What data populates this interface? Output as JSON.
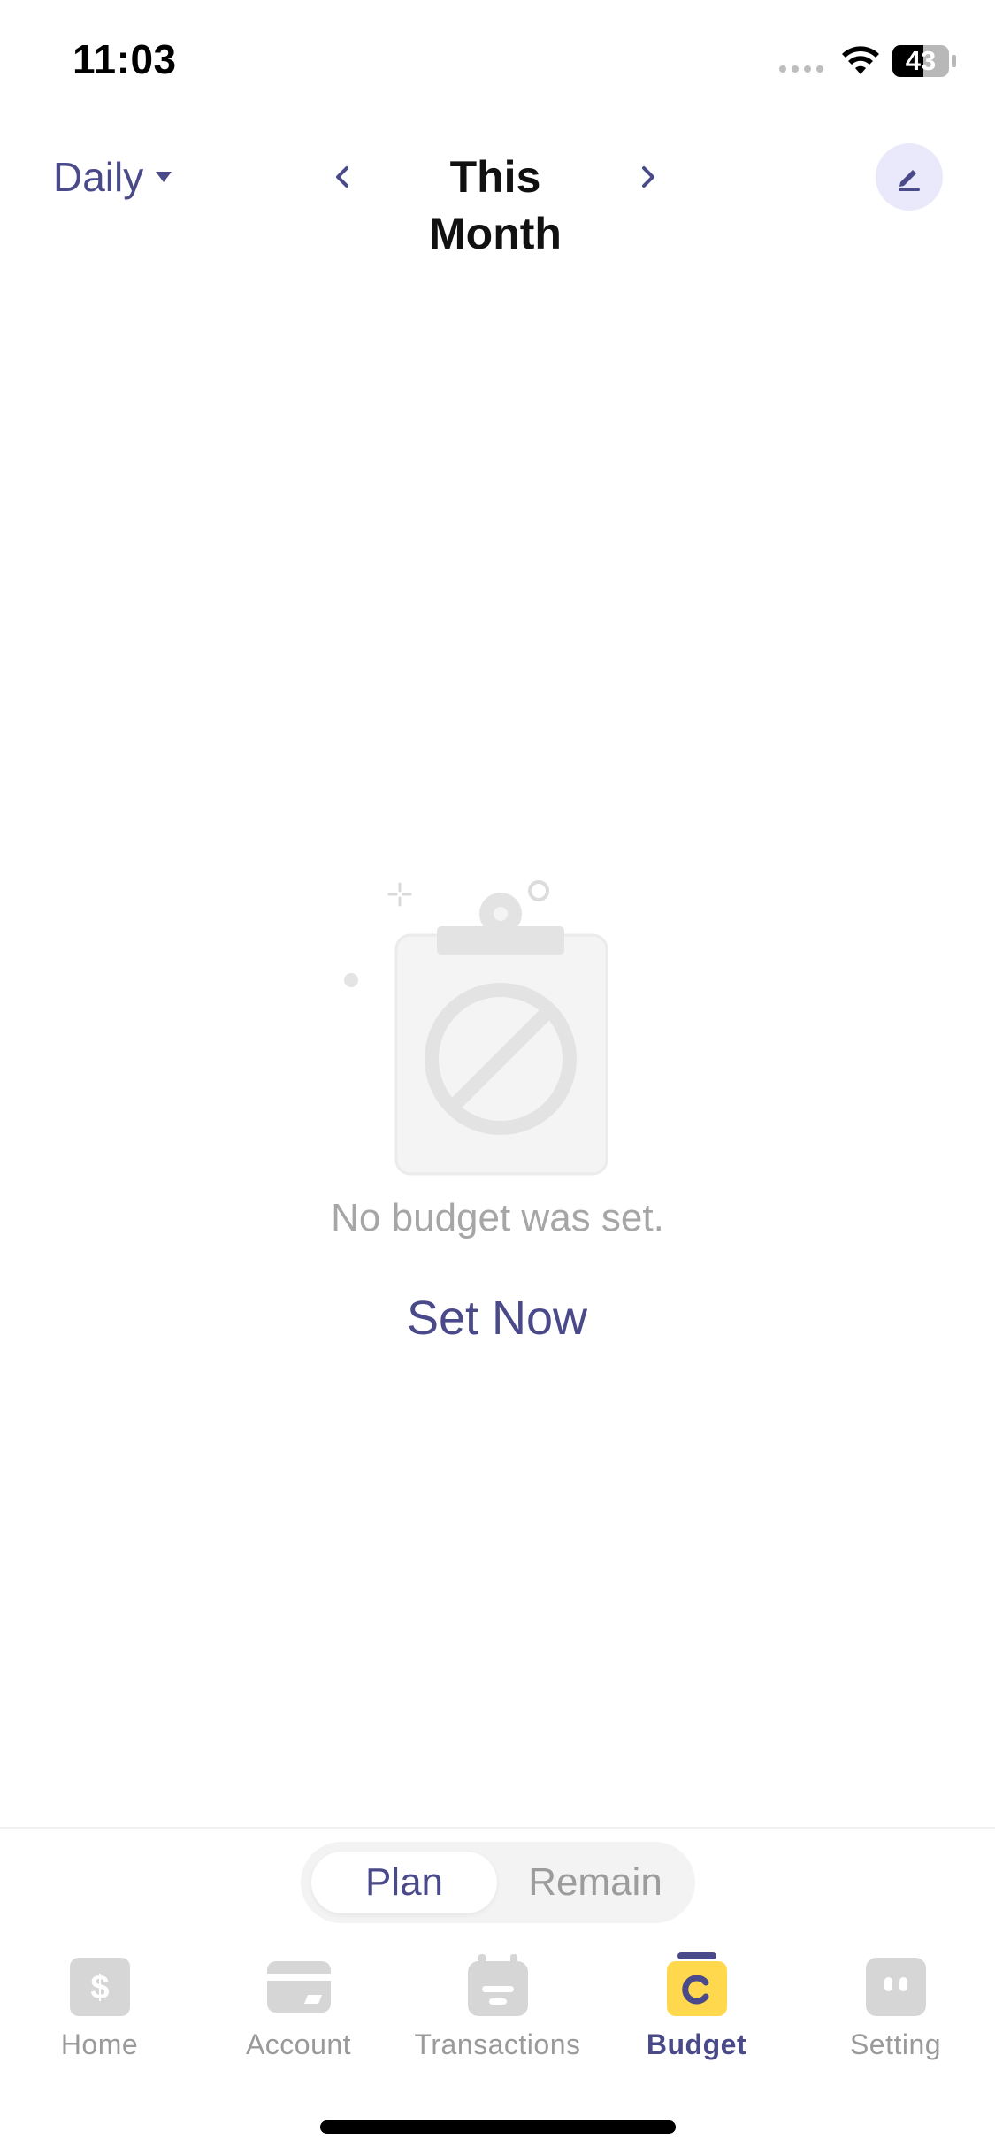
{
  "status_bar": {
    "time": "11:03",
    "battery": "43",
    "icons": [
      "signal-icon",
      "wifi-icon",
      "battery-icon"
    ]
  },
  "header": {
    "period": "Daily",
    "title": "This Month",
    "icons": {
      "period_caret": "caret-down-icon",
      "prev": "chevron-left-icon",
      "next": "chevron-right-icon",
      "edit": "pencil-icon"
    }
  },
  "empty_state": {
    "message": "No budget was set.",
    "action": "Set Now",
    "icon": "empty-clipboard-icon"
  },
  "segmented": {
    "options": [
      "Plan",
      "Remain"
    ],
    "selected": "Plan"
  },
  "tabs": [
    {
      "label": "Home",
      "icon": "dollar-wallet-icon",
      "active": false
    },
    {
      "label": "Account",
      "icon": "card-icon",
      "active": false
    },
    {
      "label": "Transactions",
      "icon": "calendar-list-icon",
      "active": false
    },
    {
      "label": "Budget",
      "icon": "budget-ring-icon",
      "active": true
    },
    {
      "label": "Setting",
      "icon": "settings-face-icon",
      "active": false
    }
  ],
  "colors": {
    "accent": "#4a4a8a",
    "accent_soft": "#e9e9fb",
    "budget_yellow": "#ffd84d",
    "inactive_gray": "#d4d4d4",
    "muted_text": "#a6a6a6"
  }
}
